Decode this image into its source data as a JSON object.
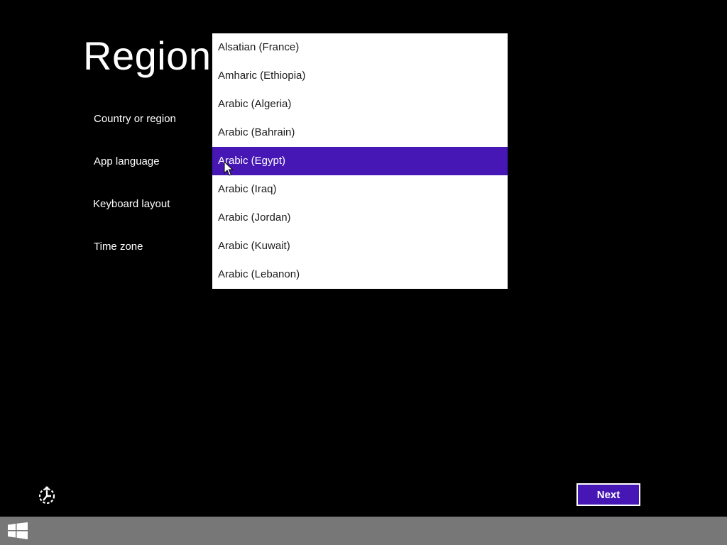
{
  "page": {
    "title": "Region"
  },
  "fields": [
    {
      "label": "Country or region"
    },
    {
      "label": "App language"
    },
    {
      "label": "Keyboard layout"
    },
    {
      "label": "Time zone"
    }
  ],
  "dropdown": {
    "options": [
      "Alsatian (France)",
      "Amharic (Ethiopia)",
      "Arabic (Algeria)",
      "Arabic (Bahrain)",
      "Arabic (Egypt)",
      "Arabic (Iraq)",
      "Arabic (Jordan)",
      "Arabic (Kuwait)",
      "Arabic (Lebanon)"
    ],
    "selected_index": 4
  },
  "buttons": {
    "next_label": "Next"
  },
  "icons": {
    "ease_of_access": "ease-of-access-icon",
    "start": "windows-start-icon",
    "cursor": "mouse-cursor-icon"
  },
  "colors": {
    "background": "#000000",
    "accent": "#4617b4",
    "list_background": "#ffffff",
    "taskbar": "#777777"
  }
}
